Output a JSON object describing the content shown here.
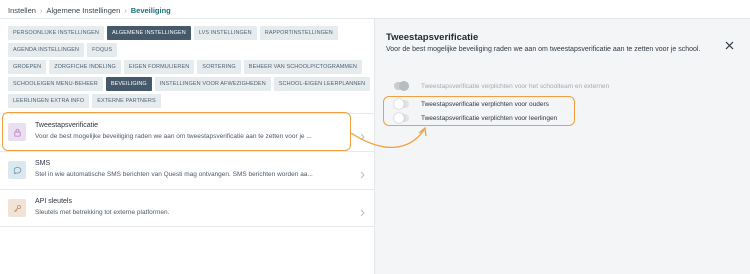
{
  "breadcrumb": {
    "items": [
      "Instellen",
      "Algemene Instellingen"
    ],
    "current": "Beveiliging"
  },
  "tabs": [
    [
      {
        "label": "PERSOONLIJKE INSTELLINGEN",
        "active": false
      },
      {
        "label": "ALGEMENE INSTELLINGEN",
        "active": true
      },
      {
        "label": "LVS INSTELLINGEN",
        "active": false
      },
      {
        "label": "RAPPORTINSTELLINGEN",
        "active": false
      }
    ],
    [
      {
        "label": "AGENDA INSTELLINGEN",
        "active": false
      },
      {
        "label": "FOQUS",
        "active": false
      }
    ],
    [
      {
        "label": "GROEPEN",
        "active": false
      },
      {
        "label": "ZORGFICHE INDELING",
        "active": false
      },
      {
        "label": "EIGEN FORMULIEREN",
        "active": false
      },
      {
        "label": "SORTERING",
        "active": false
      },
      {
        "label": "BEHEER VAN SCHOOLPICTOGRAMMEN",
        "active": false
      }
    ],
    [
      {
        "label": "SCHOOLEIGEN MENU-BEHEER",
        "active": false
      },
      {
        "label": "BEVEILIGING",
        "active": true
      },
      {
        "label": "INSTELLINGEN VOOR AFWEZIGHEDEN",
        "active": false
      },
      {
        "label": "SCHOOL-EIGEN LEERPLANNEN",
        "active": false
      }
    ],
    [
      {
        "label": "LEERLINGEN EXTRA INFO",
        "active": false
      },
      {
        "label": "EXTERNE PARTNERS",
        "active": false
      }
    ]
  ],
  "settings_list": [
    {
      "icon": "lock-icon",
      "title": "Tweestapsverificatie",
      "description": "Voor de best mogelijke beveiliging raden we aan om tweestapsverificatie aan te zetten voor je ..."
    },
    {
      "icon": "chat-bubble-icon",
      "title": "SMS",
      "description": "Stel in wie automatische SMS berichten van Questi mag ontvangen. SMS berichten worden aa..."
    },
    {
      "icon": "key-icon",
      "title": "API sleutels",
      "description": "Sleutels met betrekking tot externe platformen."
    }
  ],
  "detail": {
    "title": "Tweestapsverificatie",
    "description": "Voor de best mogelijke beveiliging raden we aan om tweestapsverificatie aan te zetten voor je school.",
    "toggles": [
      {
        "label": "Tweestapsverificatie verplichten voor het schoolteam en externen",
        "on": false,
        "disabled": true
      },
      {
        "label": "Tweestapsverificatie verplichten voor ouders",
        "on": false,
        "disabled": false
      },
      {
        "label": "Tweestapsverificatie verplichten voor leerlingen",
        "on": false,
        "disabled": false
      }
    ]
  },
  "colors": {
    "accent": "#1f6f78",
    "active_tab": "#45596a",
    "highlight": "#f0a040"
  }
}
